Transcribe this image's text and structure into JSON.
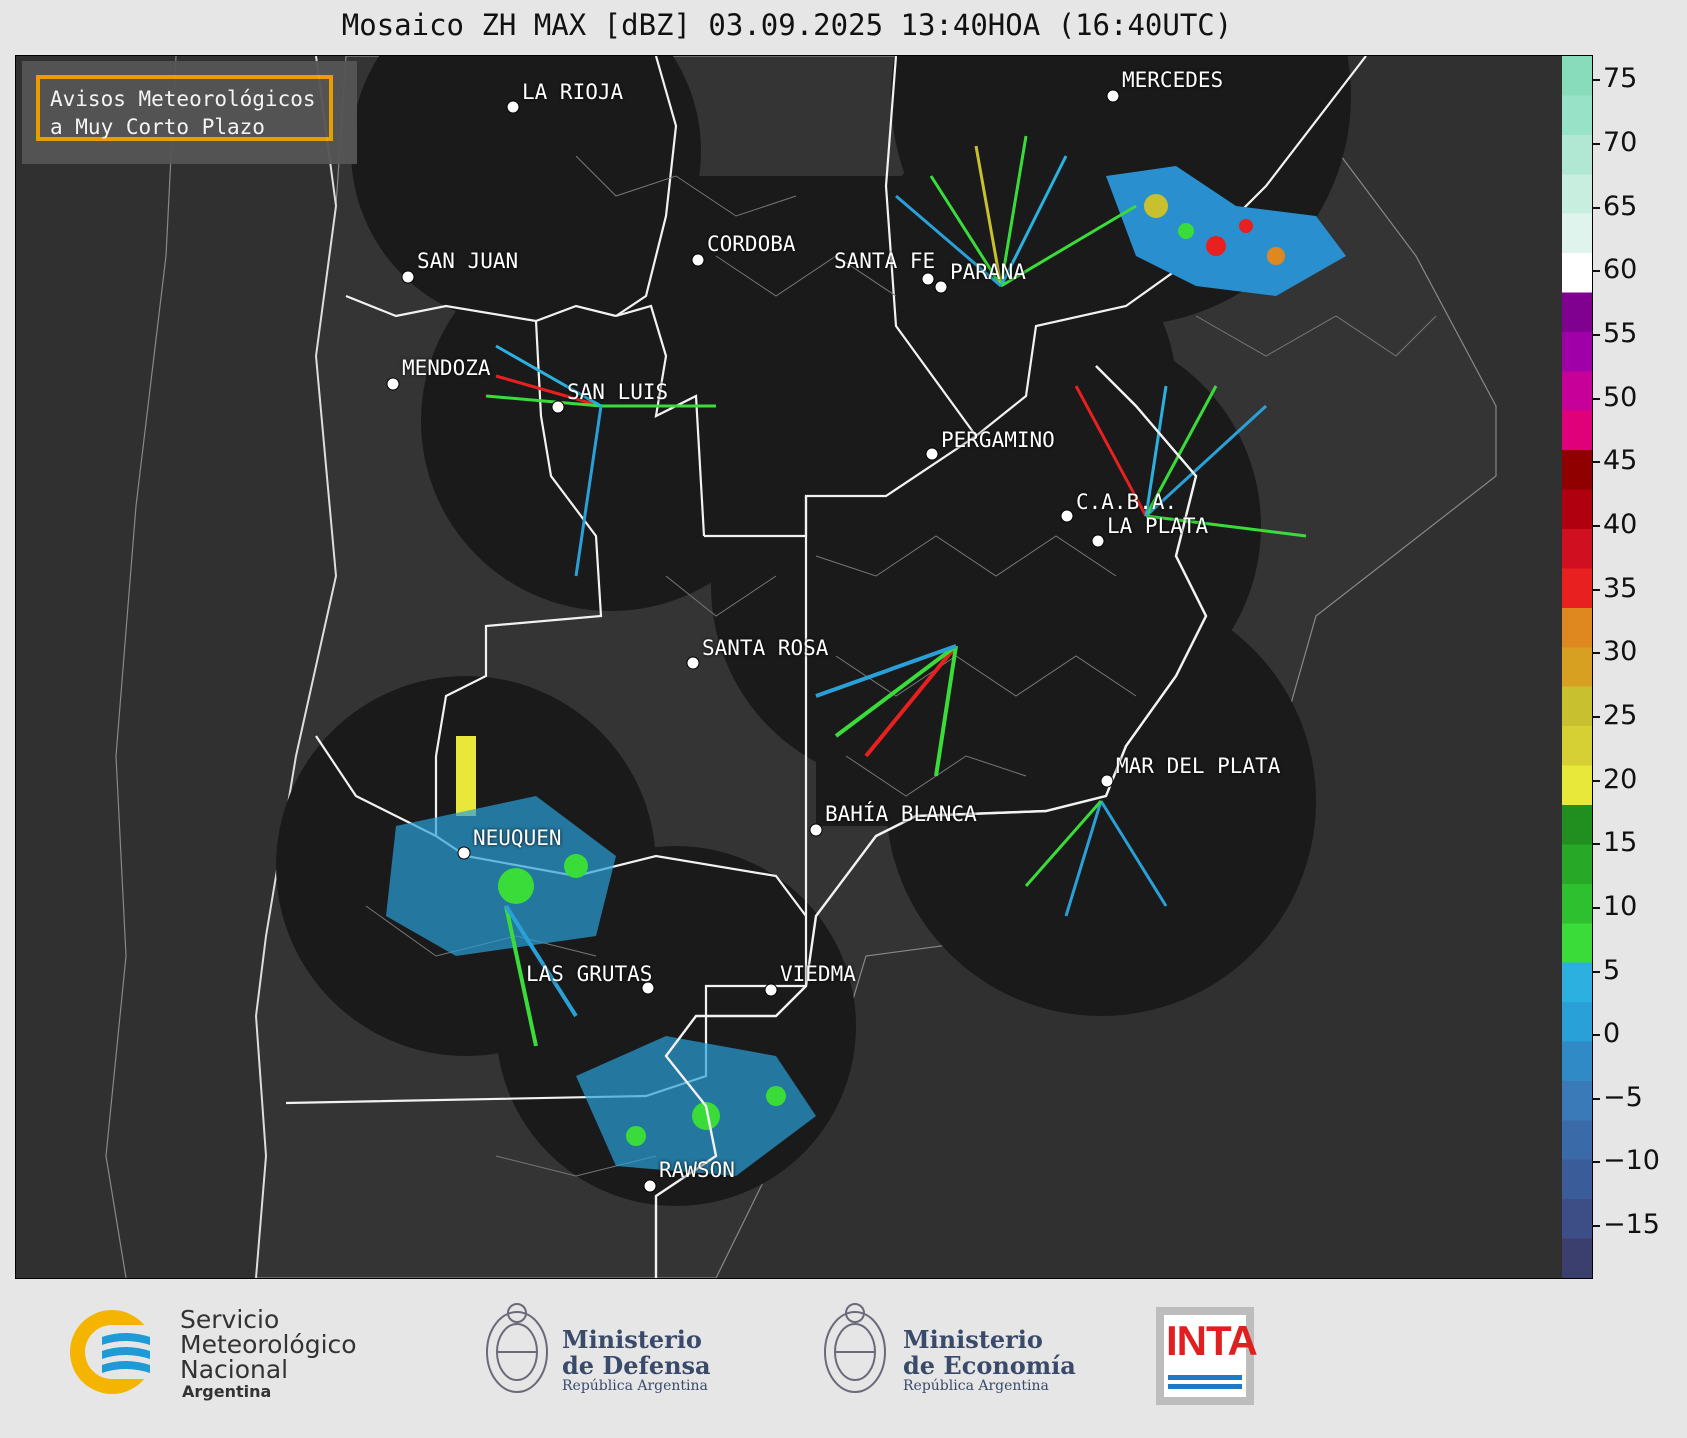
{
  "title": "Mosaico ZH MAX [dBZ] 03.09.2025 13:40HOA (16:40UTC)",
  "aviso": {
    "line1": "Avisos Meteorológicos",
    "line2": "a Muy Corto Plazo",
    "border_color": "#f5a300"
  },
  "cities": [
    {
      "name": "LA RIOJA"
    },
    {
      "name": "MERCEDES"
    },
    {
      "name": "CORDOBA"
    },
    {
      "name": "SAN JUAN"
    },
    {
      "name": "SANTA FE"
    },
    {
      "name": "PARANA"
    },
    {
      "name": "MENDOZA"
    },
    {
      "name": "SAN LUIS"
    },
    {
      "name": "PERGAMINO"
    },
    {
      "name": "C.A.B.A."
    },
    {
      "name": "LA PLATA"
    },
    {
      "name": "SANTA ROSA"
    },
    {
      "name": "MAR DEL PLATA"
    },
    {
      "name": "BAHÍA BLANCA"
    },
    {
      "name": "NEUQUEN"
    },
    {
      "name": "LAS GRUTAS"
    },
    {
      "name": "VIEDMA"
    },
    {
      "name": "RAWSON"
    }
  ],
  "colorbar": {
    "ticks": [
      "75",
      "70",
      "65",
      "60",
      "55",
      "50",
      "45",
      "40",
      "35",
      "30",
      "25",
      "20",
      "15",
      "10",
      "5",
      "0",
      "−5",
      "−10",
      "−15"
    ],
    "range": [
      -19,
      77
    ],
    "colors": [
      "#3a3f6e",
      "#3d4d86",
      "#3a5c98",
      "#3a6aa8",
      "#3a7ab8",
      "#2f8ac6",
      "#2aa0d8",
      "#2bb0e0",
      "#3adc3a",
      "#2ec02e",
      "#27a827",
      "#208f20",
      "#e8e83a",
      "#d6d034",
      "#c8c02e",
      "#d8a020",
      "#e08820",
      "#e82020",
      "#d01020",
      "#b00010",
      "#900000",
      "#e0007a",
      "#c8009a",
      "#a000a8",
      "#800090",
      "#ffffff",
      "#e0f4ee",
      "#c8eee0",
      "#b0e8d4",
      "#98e2c8",
      "#88dcbc"
    ]
  },
  "logos": {
    "smn_line1": "Servicio",
    "smn_line2": "Meteorológico",
    "smn_line3": "Nacional",
    "smn_line4": "Argentina",
    "defensa_line1": "Ministerio",
    "defensa_line2": "de Defensa",
    "defensa_line3": "República Argentina",
    "economia_line1": "Ministerio",
    "economia_line2": "de Economía",
    "economia_line3": "República Argentina",
    "inta": "INTA"
  }
}
